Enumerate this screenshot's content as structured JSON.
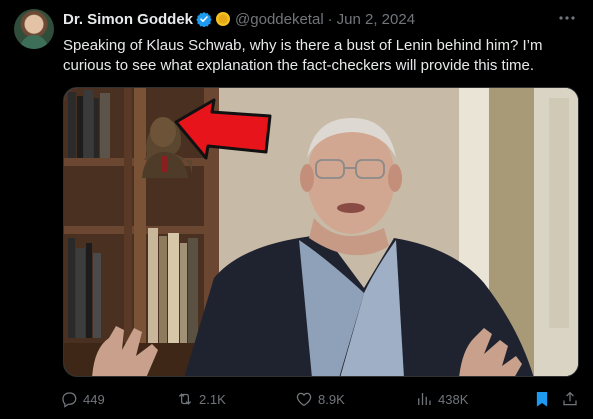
{
  "author": {
    "name": "Dr. Simon Goddek",
    "handle": "@goddeketal",
    "separator": "·",
    "date": "Jun 2, 2024",
    "verified_badge_icon": "verified-badge-icon",
    "badge_color": "#1d9bf0",
    "emoji_icon": "gold-circle-emoji"
  },
  "more_icon": "more-horizontal-icon",
  "tweet": {
    "text": "Speaking of Klaus Schwab, why is there a bust of Lenin behind him? I’m curious to see what explanation the fact-checkers will provide this time."
  },
  "media": {
    "type": "video-still",
    "annotation": "red arrow pointing at bust"
  },
  "actions": {
    "replies": "449",
    "reposts": "2.1K",
    "likes": "8.9K",
    "views": "438K"
  },
  "colors": {
    "background": "#000000",
    "text": "#e7e9ea",
    "muted": "#71767b",
    "accent": "#1d9bf0",
    "arrow": "#e8141b"
  }
}
